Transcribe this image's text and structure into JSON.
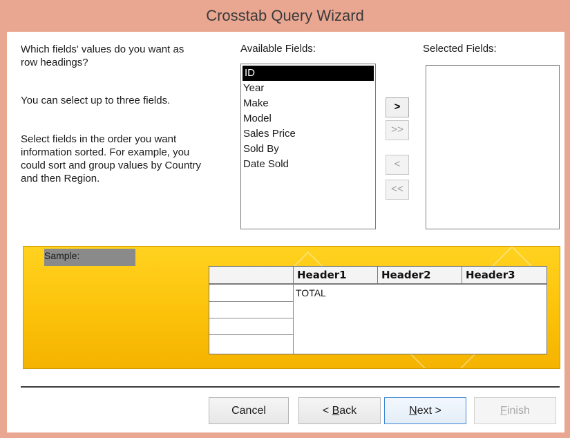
{
  "window": {
    "title": "Crosstab Query Wizard"
  },
  "instructions": {
    "line1": "Which fields' values do you want as",
    "line2": "row headings?",
    "limit": "You can select up to three fields.",
    "sort1": "Select fields in the order you want",
    "sort2": "information sorted.  For example, you",
    "sort3": "could sort and group values by Country",
    "sort4": "and then Region."
  },
  "available": {
    "label": "Available Fields:",
    "items": [
      "ID",
      "Year",
      "Make",
      "Model",
      "Sales Price",
      "Sold By",
      "Date Sold"
    ],
    "selected": "ID"
  },
  "selected_fields": {
    "label": "Selected Fields:",
    "items": []
  },
  "move_buttons": {
    "add": ">",
    "add_all": ">>",
    "remove": "<",
    "remove_all": "<<"
  },
  "sample": {
    "label": "Sample:",
    "headers": [
      "Header1",
      "Header2",
      "Header3"
    ],
    "total": "TOTAL"
  },
  "buttons": {
    "cancel": "Cancel",
    "back_prefix": "< ",
    "back_key": "B",
    "back_rest": "ack",
    "next_key": "N",
    "next_rest": "ext >",
    "finish_key": "F",
    "finish_rest": "inish"
  },
  "colors": {
    "title_bar": "#e9a792",
    "sample_bg": "#fcc20a",
    "list_selection": "#000000"
  }
}
